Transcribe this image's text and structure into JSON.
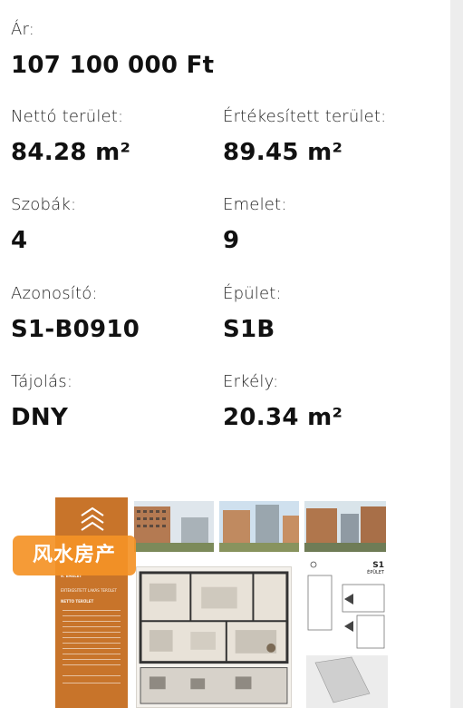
{
  "listing": {
    "price_label": "Ár:",
    "price_value": "107 100 000 Ft",
    "net_area_label": "Nettó terület:",
    "net_area_value": "84.28 m²",
    "sale_area_label": "Értékesített terület:",
    "sale_area_value": "89.45 m²",
    "rooms_label": "Szobák:",
    "rooms_value": "4",
    "floor_label": "Emelet:",
    "floor_value": "9",
    "id_label": "Azonosító:",
    "id_value": "S1-B0910",
    "building_label": "Épület",
    "building_value": "S1B",
    "orientation_label": "Tájolás:",
    "orientation_value": "DNY",
    "balcony_label": "Erkély:",
    "balcony_value": "20.34 m²"
  },
  "brochure": {
    "building_code": "S1",
    "building_word": "ÉPÜLET",
    "floor_line": "9. EMELET",
    "sold_area_line": "ÉRTÉKESÍTETT LAKÁS TERÜLET",
    "net_area_heading": "NETTÓ TERÜLET"
  },
  "watermark": {
    "text": "风水房产"
  },
  "colors": {
    "brand_orange": "#c8742a",
    "watermark_orange": "#f49226"
  }
}
